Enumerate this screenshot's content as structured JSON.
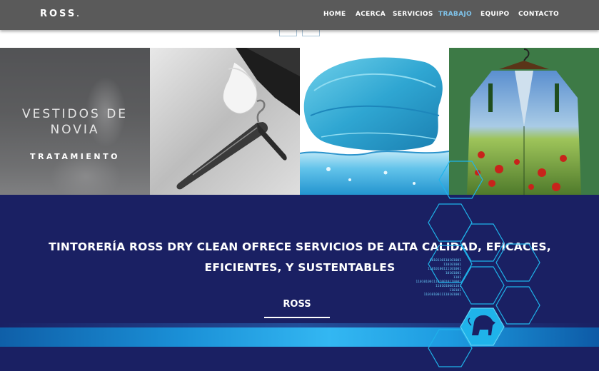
{
  "brand": {
    "logo_text": "ROSS",
    "logo_dot": "."
  },
  "nav": {
    "items": [
      {
        "label": "HOME",
        "active": false
      },
      {
        "label": "ACERCA",
        "active": false
      },
      {
        "label": "SERVICIOS",
        "active": false
      },
      {
        "label": "TRABAJO",
        "active": true
      },
      {
        "label": "EQUIPO",
        "active": false
      },
      {
        "label": "CONTACTO",
        "active": false
      }
    ],
    "active_color": "#7fc3ea"
  },
  "slider": {
    "prev_icon": "chevron-left-icon",
    "next_icon": "chevron-right-icon"
  },
  "tiles": [
    {
      "title": "VESTIDOS DE NOVIA",
      "subtitle": "TRATAMIENTO",
      "image": "wedding-dress-photo"
    },
    {
      "image": "gloved-hand-hanger-photo"
    },
    {
      "image": "blue-comforter-water-photo"
    },
    {
      "image": "floral-landscape-suit-photo"
    }
  ],
  "hero": {
    "title_line1": "TINTORERÍA ROSS DRY CLEAN OFRECE SERVICIOS DE ALTA CALIDAD, EFICACES,",
    "title_line2": "EFICIENTES, Y SUSTENTABLES",
    "brand_label": "ROSS",
    "binary_lines": [
      "0010110110101001",
      "110101001",
      "11010100111101001",
      "10101001",
      "1101",
      "11010100111010010110001",
      "1101010001101",
      "110101",
      "1101010011110101001"
    ],
    "lion_icon": "lion-icon",
    "background_color": "#1a2063",
    "stripe_color": "#33b7f2",
    "hex_color": "#1fb3ea"
  }
}
